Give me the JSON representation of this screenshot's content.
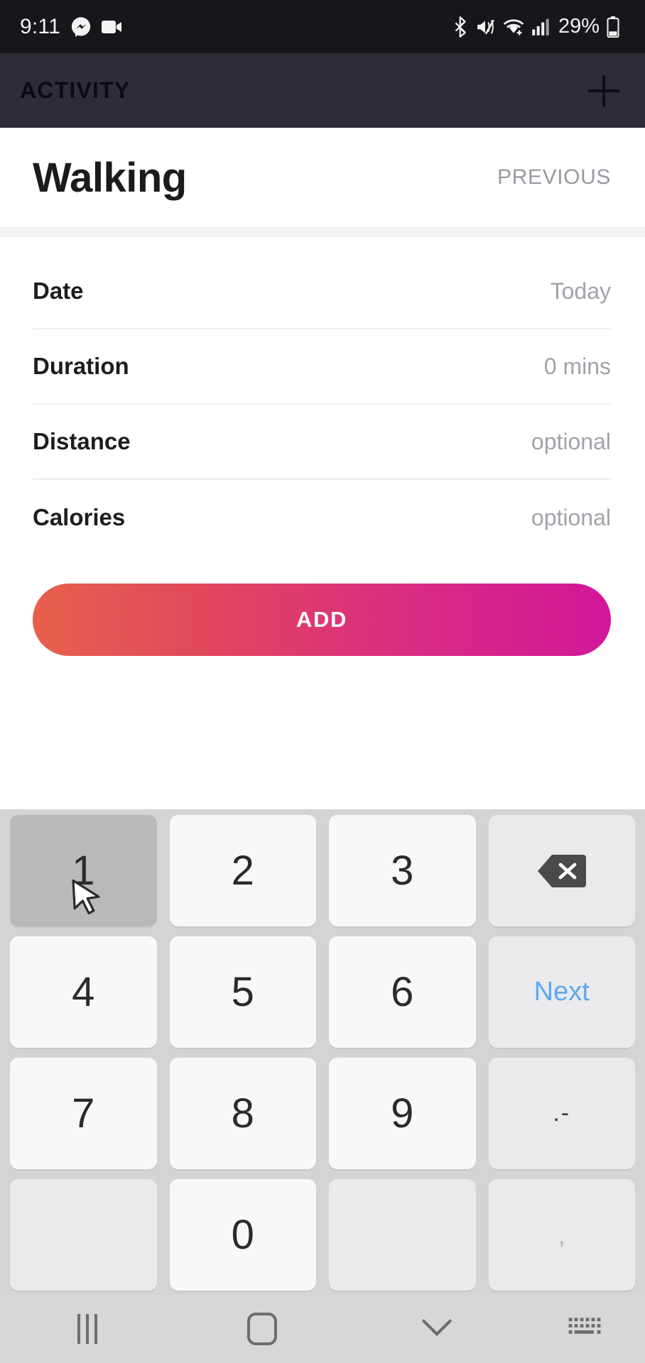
{
  "status_bar": {
    "time": "9:11",
    "battery_percent": "29%",
    "left_icons": [
      "messenger-icon",
      "video-camera-icon"
    ],
    "right_icons": [
      "bluetooth-icon",
      "mute-icon",
      "wifi-icon",
      "signal-icon",
      "battery-icon"
    ]
  },
  "app_header": {
    "title": "ACTIVITY",
    "add_icon": "plus-icon"
  },
  "title_section": {
    "activity_name": "Walking",
    "previous_label": "PREVIOUS"
  },
  "form": {
    "fields": [
      {
        "label": "Date",
        "value": "Today"
      },
      {
        "label": "Duration",
        "value": "0 mins"
      },
      {
        "label": "Distance",
        "value": "optional"
      },
      {
        "label": "Calories",
        "value": "optional"
      }
    ],
    "submit_label": "ADD"
  },
  "keyboard": {
    "rows": [
      [
        {
          "label": "1",
          "name": "key-1",
          "state": "pressed",
          "kind": "digit"
        },
        {
          "label": "2",
          "name": "key-2",
          "state": "normal",
          "kind": "digit"
        },
        {
          "label": "3",
          "name": "key-3",
          "state": "normal",
          "kind": "digit"
        },
        {
          "label": "",
          "name": "backspace-icon",
          "state": "fn",
          "kind": "backspace"
        }
      ],
      [
        {
          "label": "4",
          "name": "key-4",
          "state": "normal",
          "kind": "digit"
        },
        {
          "label": "5",
          "name": "key-5",
          "state": "normal",
          "kind": "digit"
        },
        {
          "label": "6",
          "name": "key-6",
          "state": "normal",
          "kind": "digit"
        },
        {
          "label": "Next",
          "name": "key-next",
          "state": "fn",
          "kind": "next"
        }
      ],
      [
        {
          "label": "7",
          "name": "key-7",
          "state": "normal",
          "kind": "digit"
        },
        {
          "label": "8",
          "name": "key-8",
          "state": "normal",
          "kind": "digit"
        },
        {
          "label": "9",
          "name": "key-9",
          "state": "normal",
          "kind": "digit"
        },
        {
          "label": ".-",
          "name": "key-period-dash",
          "state": "fn",
          "kind": "punct"
        }
      ],
      [
        {
          "label": "",
          "name": "key-blank-left",
          "state": "blank",
          "kind": "blank"
        },
        {
          "label": "0",
          "name": "key-0",
          "state": "normal",
          "kind": "digit"
        },
        {
          "label": "",
          "name": "key-blank-right",
          "state": "blank",
          "kind": "blank"
        },
        {
          "label": ",",
          "name": "key-comma",
          "state": "fn",
          "kind": "comma"
        }
      ]
    ]
  },
  "nav_bar": {
    "items": [
      "recents-icon",
      "home-icon",
      "hide-keyboard-chevron-icon",
      "keyboard-switch-icon"
    ]
  },
  "colors": {
    "status_bar_bg": "#16171b",
    "header_bg": "#2c2d37",
    "accent_gradient_start": "#e8604c",
    "accent_gradient_end": "#d2169a",
    "keyboard_bg": "#d4d4d6",
    "next_key_text": "#5aa9f0",
    "muted_text": "#a2a2aa"
  }
}
